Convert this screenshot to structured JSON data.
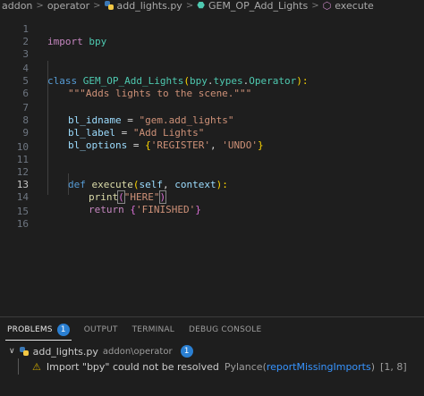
{
  "breadcrumb": {
    "items": [
      "addon",
      "operator",
      "add_lights.py",
      "GEM_OP_Add_Lights",
      "execute"
    ],
    "separator": ">"
  },
  "editor": {
    "line_numbers": [
      "1",
      "2",
      "3",
      "4",
      "5",
      "6",
      "7",
      "8",
      "9",
      "10",
      "11",
      "12",
      "13",
      "14",
      "15",
      "16"
    ],
    "active_line": "13",
    "code": {
      "l1_import": "import",
      "l1_module": "bpy",
      "l3_class": "class",
      "l3_name": "GEM_OP_Add_Lights",
      "l3_paren_open": "(",
      "l3_base_mod": "bpy",
      "l3_dot1": ".",
      "l3_base_types": "types",
      "l3_dot2": ".",
      "l3_base_cls": "Operator",
      "l3_paren_close": "):",
      "l4_doc": "\"\"\"Adds lights to the scene.\"\"\"",
      "l6_var": "bl_idname",
      "l6_eq": " = ",
      "l6_val": "\"gem.add_lights\"",
      "l7_var": "bl_label",
      "l7_eq": " = ",
      "l7_val": "\"Add Lights\"",
      "l8_var": "bl_options",
      "l8_eq": " = ",
      "l8_brace_open": "{",
      "l8_val1": "'REGISTER'",
      "l8_comma": ", ",
      "l8_val2": "'UNDO'",
      "l8_brace_close": "}",
      "l12_def": "def",
      "l12_name": "execute",
      "l12_paren_open": "(",
      "l12_self": "self",
      "l12_comma": ", ",
      "l12_ctx": "context",
      "l12_paren_close": "):",
      "l13_fn": "print",
      "l13_paren_open": "(",
      "l13_str": "\"HERE\"",
      "l13_paren_close": ")",
      "l14_return": "return",
      "l14_brace_open": "{",
      "l14_val": "'FINISHED'",
      "l14_brace_close": "}"
    }
  },
  "panel": {
    "tabs": [
      {
        "label": "PROBLEMS",
        "badge": "1",
        "active": true
      },
      {
        "label": "OUTPUT"
      },
      {
        "label": "TERMINAL"
      },
      {
        "label": "DEBUG CONSOLE"
      }
    ],
    "file": {
      "name": "add_lights.py",
      "path": "addon\\operator",
      "count": "1"
    },
    "problem": {
      "message": "Import \"bpy\" could not be resolved",
      "source": "Pylance(",
      "rule": "reportMissingImports",
      "source_close": ")",
      "location": "[1, 8]"
    }
  },
  "colors": {
    "background": "#1e1e1e",
    "keyword": "#569cd6",
    "class_name": "#4ec9b0",
    "string": "#ce9178",
    "warning": "#cca700",
    "badge": "#2a7fd2",
    "link": "#3794ff"
  },
  "icons": {
    "file": "python-file-icon",
    "method": "method-cube-icon",
    "warning": "warning-icon",
    "expand": "chevron-down-icon"
  }
}
